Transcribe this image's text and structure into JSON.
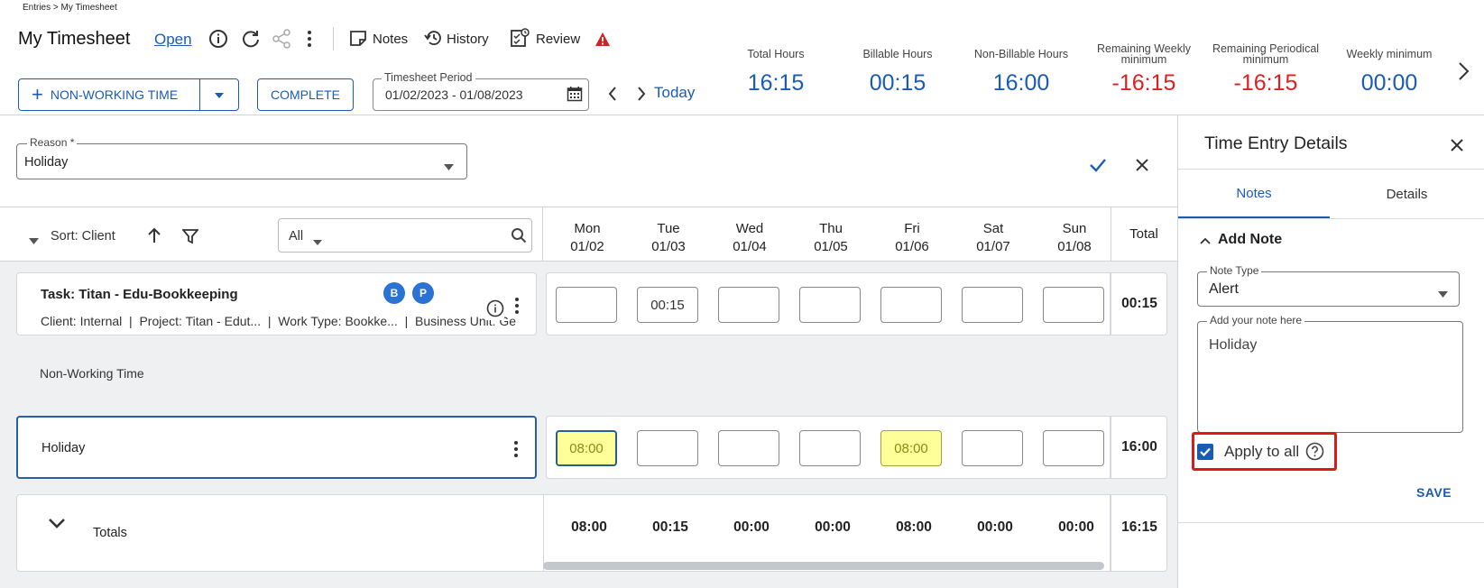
{
  "breadcrumb": "Entries > My Timesheet",
  "header": {
    "title": "My Timesheet",
    "status_link": "Open",
    "notes_label": "Notes",
    "history_label": "History",
    "review_label": "Review"
  },
  "kpis": [
    {
      "label": "Total Hours",
      "value": "16:15",
      "color": "#1a5bb5"
    },
    {
      "label": "Billable Hours",
      "value": "00:15",
      "color": "#1a5bb5"
    },
    {
      "label": "Non-Billable Hours",
      "value": "16:00",
      "color": "#1a5bb5"
    },
    {
      "label": "Remaining Weekly minimum",
      "value": "-16:15",
      "color": "#e02020"
    },
    {
      "label": "Remaining Periodical minimum",
      "value": "-16:15",
      "color": "#e02020"
    },
    {
      "label": "Weekly minimum",
      "value": "00:00",
      "color": "#1a5bb5"
    }
  ],
  "toolbar": {
    "non_working_label": "NON-WORKING TIME",
    "complete_label": "COMPLETE",
    "period_label": "Timesheet Period",
    "period_value": "01/02/2023 - 01/08/2023",
    "today_label": "Today"
  },
  "reason": {
    "label": "Reason *",
    "value": "Holiday"
  },
  "grid": {
    "sort_label": "Sort: Client",
    "filter_value": "All",
    "days": [
      {
        "name": "Mon",
        "date": "01/02"
      },
      {
        "name": "Tue",
        "date": "01/03"
      },
      {
        "name": "Wed",
        "date": "01/04"
      },
      {
        "name": "Thu",
        "date": "01/05"
      },
      {
        "name": "Fri",
        "date": "01/06"
      },
      {
        "name": "Sat",
        "date": "01/07"
      },
      {
        "name": "Sun",
        "date": "01/08"
      }
    ],
    "total_label": "Total",
    "task": {
      "title": "Task: Titan - Edu-Bookkeeping",
      "badges": [
        "B",
        "P"
      ],
      "details": "Client: Internal  |  Project: Titan - Edut...  |  Work Type: Bookke...  |  Business Unit: Ge",
      "cells": [
        "",
        "00:15",
        "",
        "",
        "",
        "",
        ""
      ],
      "total": "00:15"
    },
    "section_label": "Non-Working Time",
    "holiday": {
      "label": "Holiday",
      "cells": [
        "08:00",
        "",
        "",
        "",
        "08:00",
        "",
        ""
      ],
      "total": "16:00"
    },
    "totals": {
      "label": "Totals",
      "values": [
        "08:00",
        "00:15",
        "00:00",
        "00:00",
        "08:00",
        "00:00",
        "00:00"
      ],
      "total": "16:15"
    }
  },
  "panel": {
    "title": "Time Entry Details",
    "tabs": [
      "Notes",
      "Details"
    ],
    "add_note_label": "Add Note",
    "note_type_label": "Note Type",
    "note_type_value": "Alert",
    "note_text_label": "Add your note here",
    "note_text_value": "Holiday",
    "apply_all_label": "Apply to all",
    "save_label": "SAVE"
  }
}
